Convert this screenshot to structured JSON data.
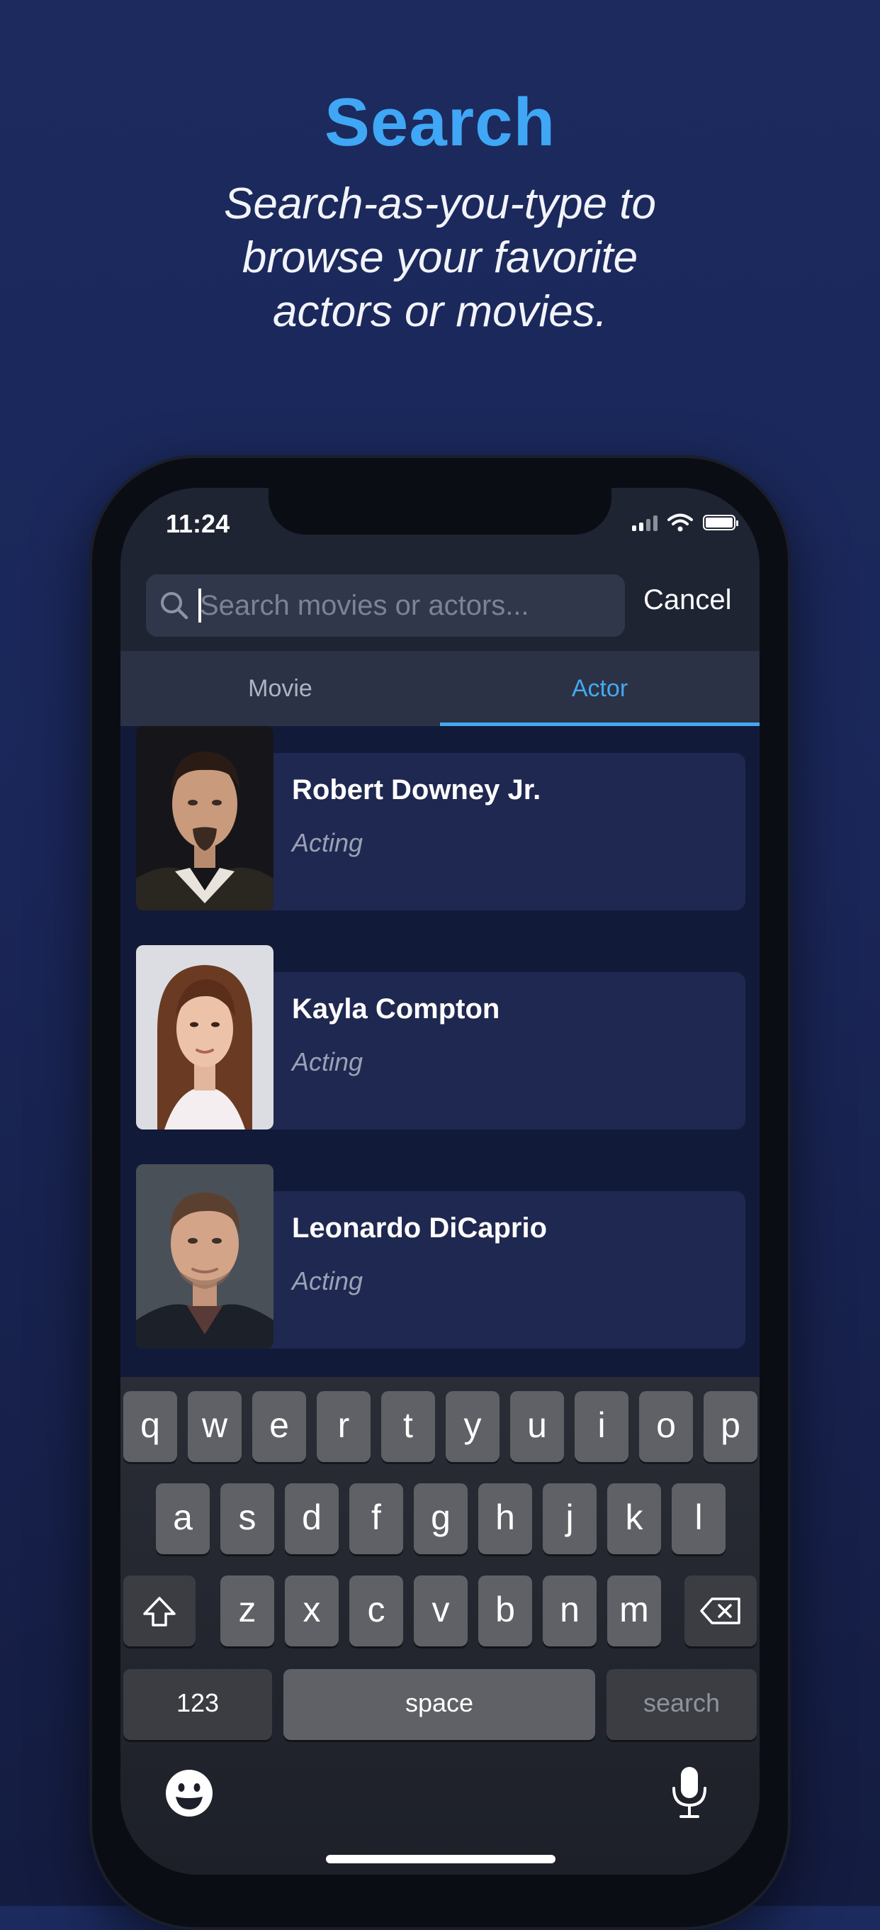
{
  "hero": {
    "title": "Search",
    "subtitle": "Search-as-you-type to browse your favorite actors or movies."
  },
  "status_bar": {
    "time": "11:24"
  },
  "search": {
    "placeholder": "Search movies or actors...",
    "value": "",
    "cancel_label": "Cancel"
  },
  "tabs": [
    {
      "label": "Movie",
      "active": false
    },
    {
      "label": "Actor",
      "active": true
    }
  ],
  "results": [
    {
      "name": "Robert Downey Jr.",
      "role": "Acting"
    },
    {
      "name": "Kayla Compton",
      "role": "Acting"
    },
    {
      "name": "Leonardo DiCaprio",
      "role": "Acting"
    }
  ],
  "keyboard": {
    "row1": [
      "q",
      "w",
      "e",
      "r",
      "t",
      "y",
      "u",
      "i",
      "o",
      "p"
    ],
    "row2": [
      "a",
      "s",
      "d",
      "f",
      "g",
      "h",
      "j",
      "k",
      "l"
    ],
    "row3": [
      "z",
      "x",
      "c",
      "v",
      "b",
      "n",
      "m"
    ],
    "numbers_label": "123",
    "space_label": "space",
    "search_label": "search",
    "shift_icon": "shift-icon",
    "delete_icon": "backspace-icon",
    "emoji_icon": "emoji-icon",
    "dictation_icon": "microphone-icon"
  },
  "colors": {
    "accent": "#45a8f2",
    "background": "#1c2a5e",
    "card": "#1f2850"
  }
}
